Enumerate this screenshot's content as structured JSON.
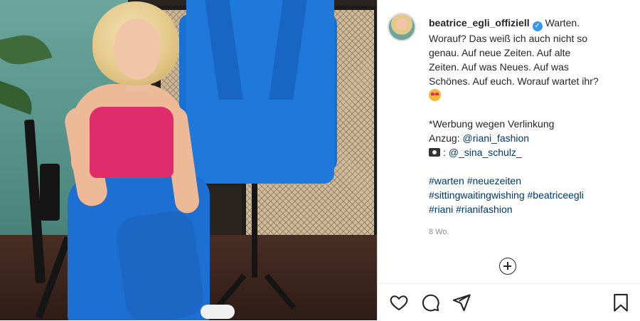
{
  "post": {
    "username": "beatrice_egli_offiziell",
    "caption_lines": [
      "Warten.",
      "Worauf? Das weiß ich auch nicht so",
      "genau. Auf neue Zeiten. Auf alte",
      "Zeiten. Auf was Neues. Auf was",
      "Schönes. Auf euch. Worauf wartet ihr?"
    ],
    "ad_note": "*Werbung wegen Verlinkung",
    "suit_label": "Anzug:",
    "suit_link": "@riani_fashion",
    "photo_link": "@_sina_schulz_",
    "hashtags_line1": "#warten #neuezeiten",
    "hashtags_line2": "#sittingwaitingwishing #beatriceegli",
    "hashtags_line3": "#riani #rianifashion",
    "timestamp": "8 Wo."
  },
  "icons": {
    "verified": "verified-badge-icon",
    "emoji": "heart-eyes-emoji-icon",
    "camera": "camera-icon",
    "add_comment": "plus-circle-icon",
    "like": "heart-icon",
    "comment": "comment-icon",
    "share": "send-icon",
    "save": "bookmark-icon"
  },
  "colors": {
    "link": "#00376b",
    "verified": "#3897f0",
    "text": "#262626",
    "muted": "#8e8e8e"
  }
}
